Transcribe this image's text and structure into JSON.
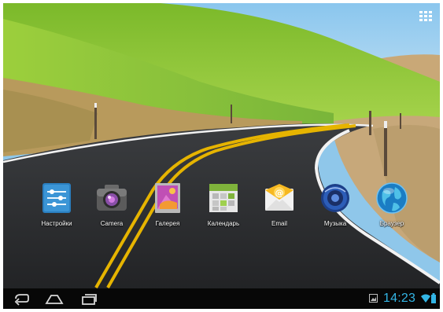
{
  "launcher": {
    "apps": [
      {
        "label": "Настройки",
        "icon": "settings-icon"
      },
      {
        "label": "Camera",
        "icon": "camera-icon"
      },
      {
        "label": "Галерея",
        "icon": "gallery-icon"
      },
      {
        "label": "Календарь",
        "icon": "calendar-icon"
      },
      {
        "label": "Email",
        "icon": "email-icon"
      },
      {
        "label": "Музыка",
        "icon": "music-icon"
      },
      {
        "label": "Браузер",
        "icon": "browser-icon"
      }
    ],
    "all_apps_icon": "apps-grid-icon"
  },
  "navbar": {
    "buttons": [
      "back-icon",
      "home-icon",
      "recent-apps-icon"
    ]
  },
  "status": {
    "time": "14:23",
    "icons": [
      "gallery-notification-icon",
      "wifi-icon",
      "battery-icon"
    ],
    "accent_color": "#33b5e5"
  },
  "wallpaper": "road-through-green-hills"
}
